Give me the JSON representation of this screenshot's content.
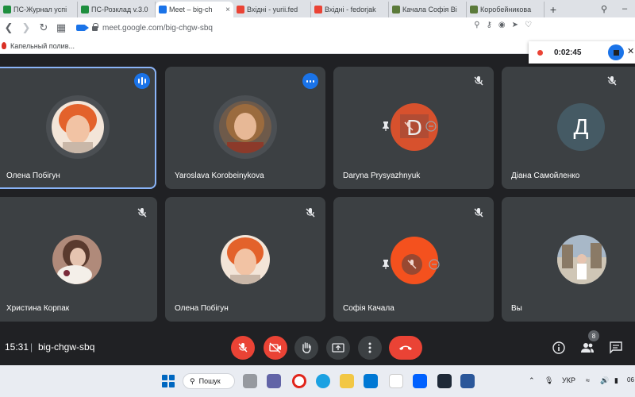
{
  "browser": {
    "tabs": [
      {
        "title": "ПС-Журнал успі",
        "favicon_color": "#1e8e3e",
        "active": false
      },
      {
        "title": "ПС-Розклад v.3.0",
        "favicon_color": "#1e8e3e",
        "active": false
      },
      {
        "title": "Meet – big-ch",
        "favicon_color": "#1a73e8",
        "active": true
      },
      {
        "title": "Вхідні - yurii.fed",
        "favicon_color": "#ea4335",
        "active": false
      },
      {
        "title": "Вхідні - fedorjak",
        "favicon_color": "#ea4335",
        "active": false
      },
      {
        "title": "Качала Софія Ві",
        "favicon_color": "#5b7a3a",
        "active": false
      },
      {
        "title": "Коробейникова",
        "favicon_color": "#5b7a3a",
        "active": false
      }
    ],
    "new_tab_label": "+",
    "url": "meet.google.com/big-chgw-sbq",
    "bookmark": "Капельный полив..."
  },
  "recording": {
    "time": "0:02:45"
  },
  "tiles": [
    {
      "name": "Олена Побігун",
      "status": "speaking"
    },
    {
      "name": "Yaroslava Korobeinykova",
      "status": "speaking"
    },
    {
      "name": "Daryna Prysyazhnyuk",
      "status": "muted"
    },
    {
      "name": "Діана Самойленко",
      "status": "muted",
      "initial": "Д"
    },
    {
      "name": "Христина Корпак",
      "status": "muted"
    },
    {
      "name": "Олена Побігун",
      "status": "muted"
    },
    {
      "name": "Софія Качала",
      "status": "muted"
    },
    {
      "name": "Вы",
      "status": "self"
    }
  ],
  "meeting": {
    "clock": "15:31",
    "code": "big-chgw-sbq",
    "people_count": "8"
  },
  "taskbar": {
    "search_label": "Пошук",
    "keyboard_layout": "УКР",
    "clock_fragment": "06"
  },
  "colors": {
    "meet_bg": "#202124",
    "tile_bg": "#3c4043",
    "speaking_border": "#8ab4f8",
    "danger_red": "#ea4335",
    "accent_blue": "#1a73e8"
  },
  "icons": {
    "mic_off": "mic-off-icon",
    "camera_off": "camera-off-icon",
    "raise_hand": "raise-hand-icon",
    "present": "present-screen-icon",
    "more": "more-options-icon",
    "end_call": "end-call-icon",
    "info": "info-icon",
    "people": "people-icon",
    "chat": "chat-icon"
  }
}
